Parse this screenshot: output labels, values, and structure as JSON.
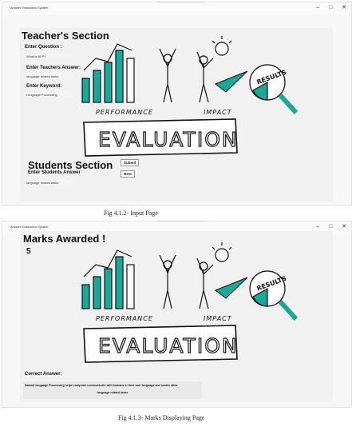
{
  "app": {
    "title": "Answer Evaluation System",
    "minimize": "–",
    "maximize": "□",
    "close": "✕"
  },
  "page1": {
    "teacher_heading": "Teacher's Section",
    "question_label": "Enter Question :",
    "question_value": "What is NLP?",
    "teacher_answer_label": "Enter Teachers Answer:",
    "teacher_answer_value": "language related tasks",
    "keyword_label": "Enter Keyword:",
    "keyword_value": "Language Processing",
    "student_heading": "Students Section",
    "student_answer_label": "Enter Students Answer",
    "student_answer_value": "language related tasks",
    "submit_label": "Submit",
    "next_label": "Next",
    "caption": "Fig 4.1.2-  Input Page"
  },
  "page2": {
    "marks_heading": "Marks Awarded !",
    "marks_value": "5",
    "correct_answer_label": "Correct Answer:",
    "correct_answer_line1": "Natural language Processing helps computer communicate with humans in their own language and scales other",
    "correct_answer_line2": "language related tasks",
    "caption": "Fig 4.1.3- Marks Displaying Page"
  },
  "art": {
    "performance": "PERFORMANCE",
    "impact": "IMPACT",
    "results": "RESULTS",
    "evaluation": "EVALUATION"
  },
  "colors": {
    "teal": "#1aa89a",
    "ink": "#111111"
  }
}
